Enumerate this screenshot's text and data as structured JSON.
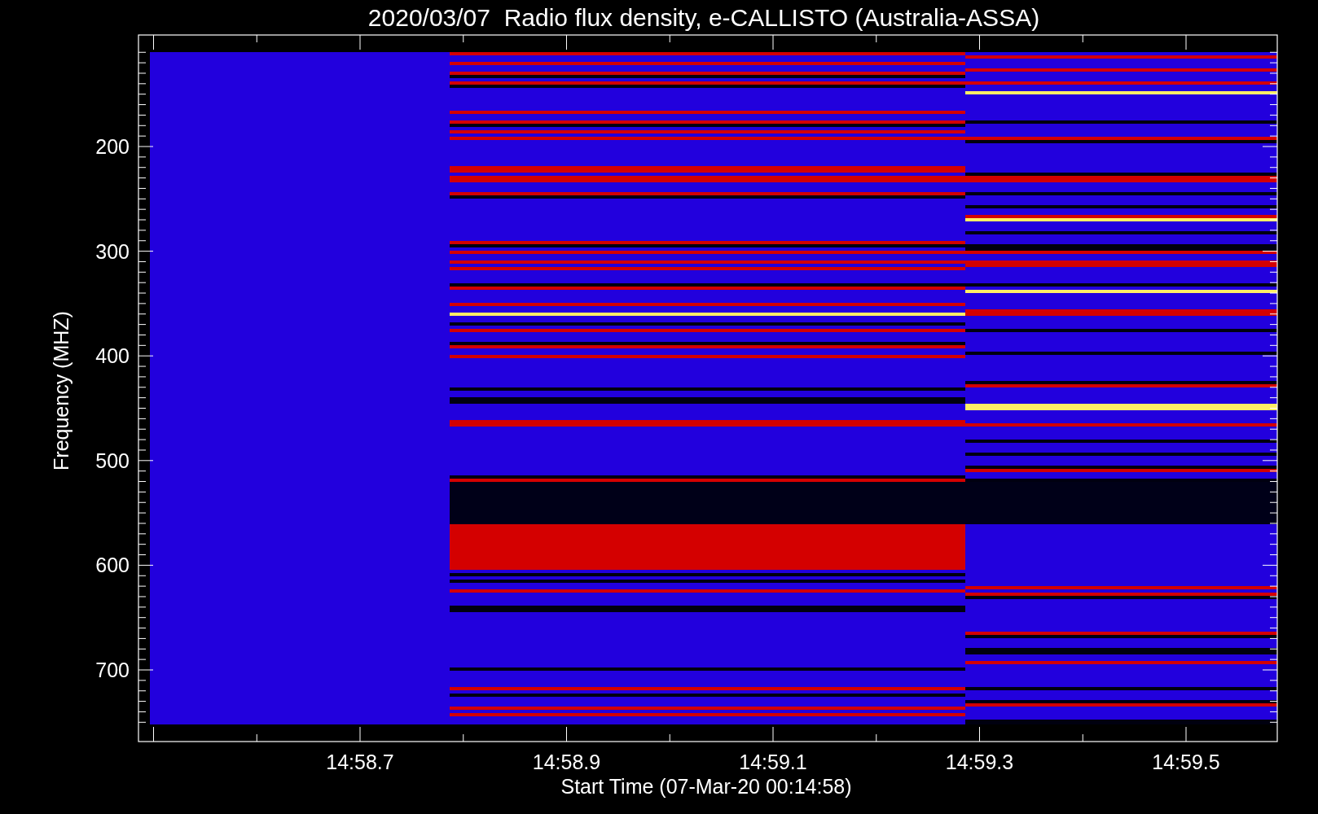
{
  "title": "2020/03/07  Radio flux density, e-CALLISTO (Australia-ASSA)",
  "y_axis": {
    "label": "Frequency (MHZ)",
    "tick_labels": [
      "200",
      "300",
      "400",
      "500",
      "600",
      "700"
    ]
  },
  "x_axis": {
    "label": "Start Time (07-Mar-20 00:14:58)",
    "tick_labels": [
      "14:58.7",
      "14:58.9",
      "14:59.1",
      "14:59.3",
      "14:59.5"
    ]
  }
}
